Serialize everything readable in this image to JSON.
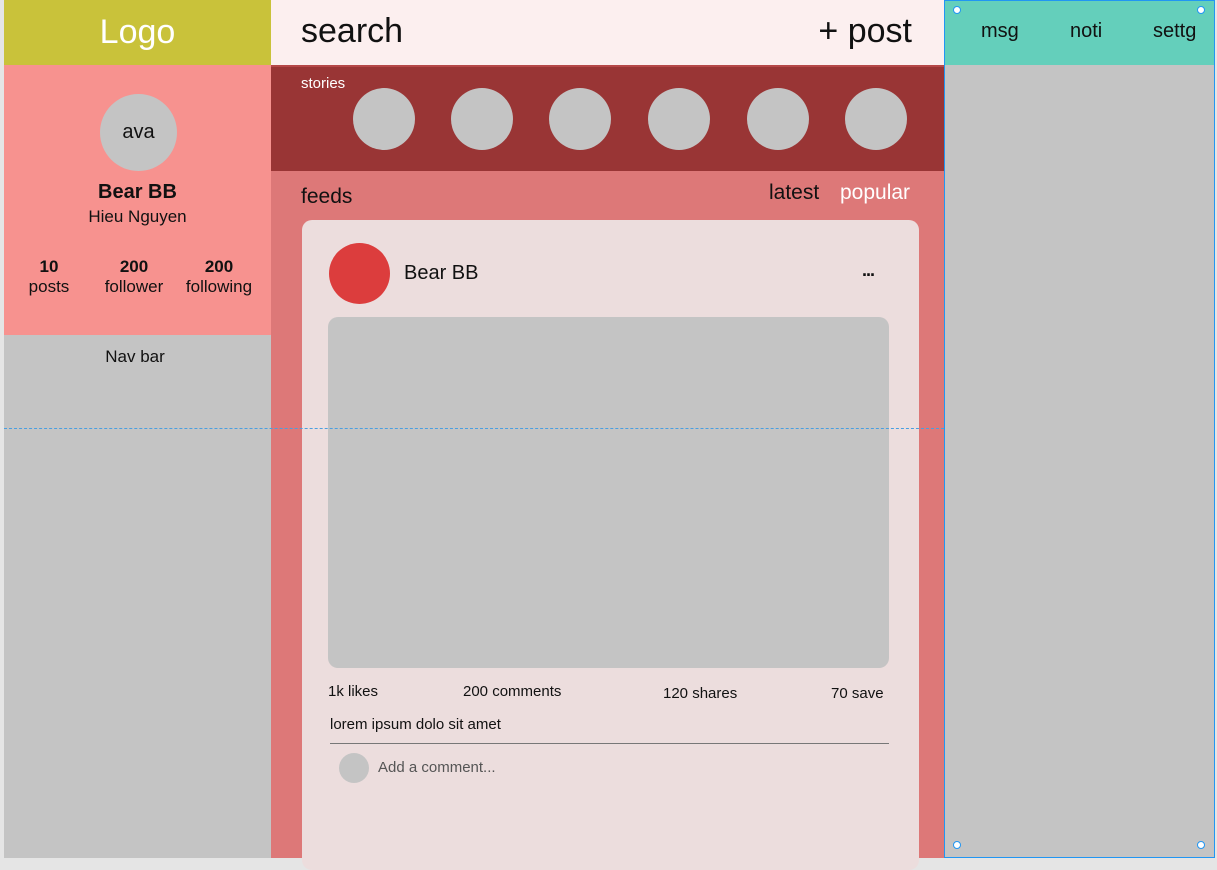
{
  "logo": {
    "text": "Logo"
  },
  "profile": {
    "avatar_label": "ava",
    "name": "Bear BB",
    "subname": "Hieu Nguyen",
    "stats": [
      {
        "number": "10",
        "label": "posts"
      },
      {
        "number": "200",
        "label": "follower"
      },
      {
        "number": "200",
        "label": "following"
      }
    ]
  },
  "navbar": {
    "label": "Nav bar"
  },
  "header": {
    "search_label": "search",
    "post_label": "+ post"
  },
  "stories": {
    "label": "stories",
    "count": 6
  },
  "feed": {
    "label": "feeds",
    "tabs": [
      {
        "label": "latest",
        "active": true
      },
      {
        "label": "popular",
        "active": false
      }
    ],
    "post": {
      "author": "Bear BB",
      "more": "...",
      "stats": {
        "likes": "1k likes",
        "comments": "200 comments",
        "shares": "120 shares",
        "saves": "70 save"
      },
      "caption": "lorem ipsum dolo sit amet",
      "comment_placeholder": "Add a comment..."
    }
  },
  "right_nav": {
    "items": [
      "msg",
      "noti",
      "settg"
    ]
  },
  "colors": {
    "logo_bg": "#c9c23a",
    "profile_bg": "#f7928f",
    "stories_bg": "#993535",
    "feed_bg": "#dd7878",
    "post_card_bg": "#ecdddd",
    "right_topbar_bg": "#64cfbb",
    "panel_gray": "#c4c4c4"
  }
}
